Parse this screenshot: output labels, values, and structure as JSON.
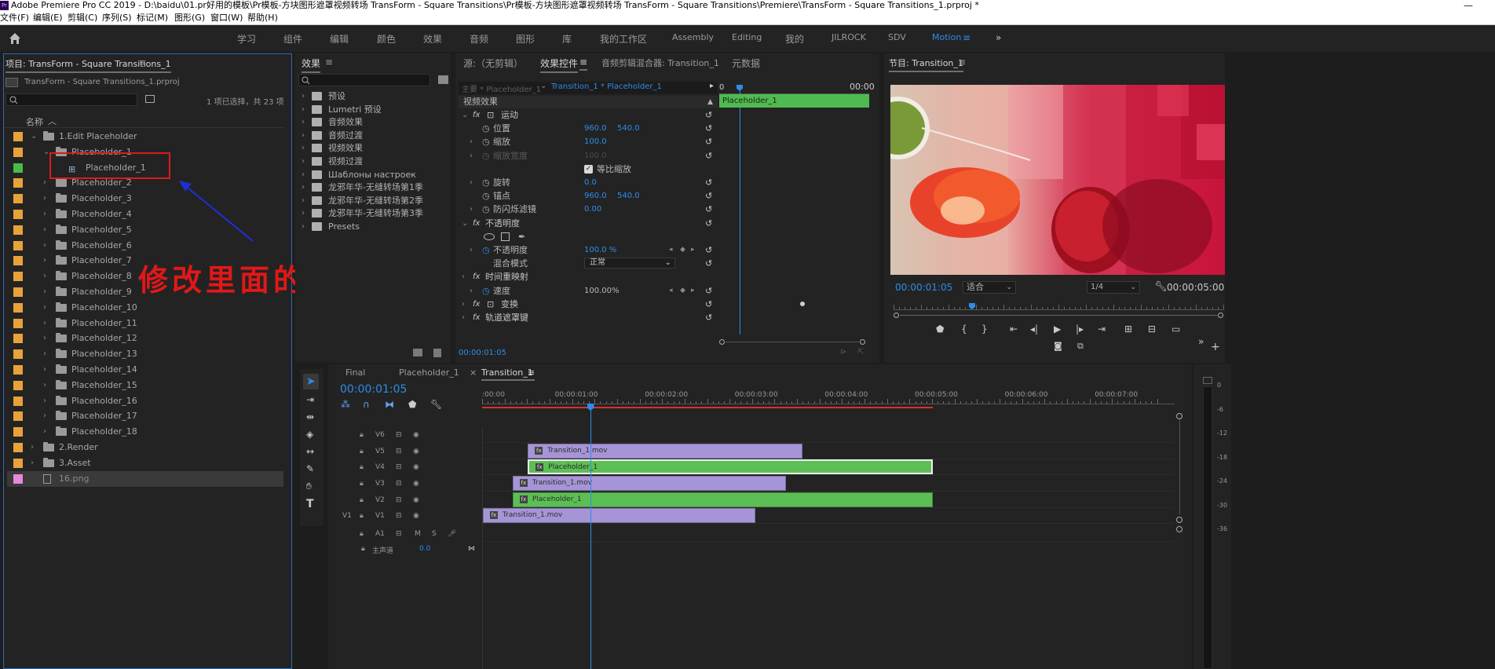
{
  "title_bar": {
    "app_badge": "Pr",
    "title": "Adobe Premiere Pro CC 2019 - D:\\baidu\\01.pr好用的模板\\Pr模板-方块图形遮罩视频转场 TransForm - Square Transitions\\Pr模板-方块图形遮罩视频转场 TransForm - Square Transitions\\Premiere\\TransForm - Square Transitions_1.prproj *",
    "minimize": "—",
    "maximize": "❐"
  },
  "menu": [
    "文件(F)",
    "编辑(E)",
    "剪辑(C)",
    "序列(S)",
    "标记(M)",
    "图形(G)",
    "窗口(W)",
    "帮助(H)"
  ],
  "workspaces": {
    "items": [
      "学习",
      "组件",
      "编辑",
      "颜色",
      "效果",
      "音频",
      "图形",
      "库",
      "我的工作区",
      "Assembly",
      "Editing",
      "我的",
      "JILROCK",
      "SDV",
      "Motion"
    ],
    "active": "Motion",
    "more": "»"
  },
  "project": {
    "tab": "项目: TransForm - Square Transitions_1",
    "file": "TransForm - Square Transitions_1.prproj",
    "selection": "1 项已选择，共 23 项",
    "column": "名称",
    "items": [
      {
        "label": "1.Edit Placeholder",
        "color": "#e8a23a",
        "depth": 0,
        "expanded": true
      },
      {
        "label": "Placeholder_1",
        "color": "#e8a23a",
        "depth": 1,
        "expanded": true
      },
      {
        "label": "Placeholder_1",
        "color": "#4aba4a",
        "depth": 2,
        "kind": "sequence"
      },
      {
        "label": "Placeholder_2",
        "color": "#e8a23a",
        "depth": 1
      },
      {
        "label": "Placeholder_3",
        "color": "#e8a23a",
        "depth": 1
      },
      {
        "label": "Placeholder_4",
        "color": "#e8a23a",
        "depth": 1
      },
      {
        "label": "Placeholder_5",
        "color": "#e8a23a",
        "depth": 1
      },
      {
        "label": "Placeholder_6",
        "color": "#e8a23a",
        "depth": 1
      },
      {
        "label": "Placeholder_7",
        "color": "#e8a23a",
        "depth": 1
      },
      {
        "label": "Placeholder_8",
        "color": "#e8a23a",
        "depth": 1
      },
      {
        "label": "Placeholder_9",
        "color": "#e8a23a",
        "depth": 1
      },
      {
        "label": "Placeholder_10",
        "color": "#e8a23a",
        "depth": 1
      },
      {
        "label": "Placeholder_11",
        "color": "#e8a23a",
        "depth": 1
      },
      {
        "label": "Placeholder_12",
        "color": "#e8a23a",
        "depth": 1
      },
      {
        "label": "Placeholder_13",
        "color": "#e8a23a",
        "depth": 1
      },
      {
        "label": "Placeholder_14",
        "color": "#e8a23a",
        "depth": 1
      },
      {
        "label": "Placeholder_15",
        "color": "#e8a23a",
        "depth": 1
      },
      {
        "label": "Placeholder_16",
        "color": "#e8a23a",
        "depth": 1
      },
      {
        "label": "Placeholder_17",
        "color": "#e8a23a",
        "depth": 1
      },
      {
        "label": "Placeholder_18",
        "color": "#e8a23a",
        "depth": 1
      },
      {
        "label": "2.Render",
        "color": "#e8a23a",
        "depth": 0
      },
      {
        "label": "3.Asset",
        "color": "#e8a23a",
        "depth": 0
      },
      {
        "label": "16.png",
        "color": "#e58ad6",
        "depth": 1,
        "kind": "image"
      }
    ]
  },
  "annotation": {
    "text": "修改里面的图片即可",
    "color": "#e01818",
    "arrow_color": "#1f2fd6"
  },
  "effects": {
    "tab": "效果",
    "items": [
      "预设",
      "Lumetri 预设",
      "音频效果",
      "音频过渡",
      "视频效果",
      "视频过渡",
      "Шаблоны настроек",
      "龙邪年华-无缝转场第1季",
      "龙邪年华-无缝转场第2季",
      "龙邪年华-无缝转场第3季",
      "Presets"
    ]
  },
  "effect_controls": {
    "tabs": [
      "源:（无剪辑）",
      "效果控件",
      "音频剪辑混合器: Transition_1",
      "元数据"
    ],
    "master": "主要 * Placeholder_1",
    "clip": "Transition_1 * Placeholder_1",
    "ruler": {
      "start": "0",
      "end": "00:00"
    },
    "clip_bar": "Placeholder_1",
    "section": "视频效果",
    "props": [
      {
        "name": "运动",
        "fx": true,
        "level": 0
      },
      {
        "name": "位置",
        "level": 1,
        "stopwatch": true,
        "v1": "960.0",
        "v2": "540.0"
      },
      {
        "name": "缩放",
        "level": 1,
        "stopwatch": true,
        "arrow": true,
        "v1": "100.0"
      },
      {
        "name": "缩放宽度",
        "level": 1,
        "stopwatch": true,
        "arrow": true,
        "v1": "100.0",
        "dim": true
      },
      {
        "name": "",
        "level": 1,
        "checkbox": "等比缩放"
      },
      {
        "name": "旋转",
        "level": 1,
        "stopwatch": true,
        "arrow": true,
        "v1": "0.0"
      },
      {
        "name": "锚点",
        "level": 1,
        "stopwatch": true,
        "v1": "960.0",
        "v2": "540.0"
      },
      {
        "name": "防闪烁滤镜",
        "level": 1,
        "stopwatch": true,
        "arrow": true,
        "v1": "0.00"
      },
      {
        "name": "不透明度",
        "fx": true,
        "level": 0
      },
      {
        "name": "",
        "level": 1,
        "shapes": true
      },
      {
        "name": "不透明度",
        "level": 1,
        "stopwatch": true,
        "arrow": true,
        "v1": "100.0 %",
        "kf": true
      },
      {
        "name": "混合模式",
        "level": 1,
        "dropdown": "正常"
      },
      {
        "name": "时间重映射",
        "fx": true,
        "level": 0
      },
      {
        "name": "速度",
        "level": 1,
        "stopwatch": true,
        "arrow": true,
        "v1": "100.00%",
        "kf": true,
        "plain": true
      },
      {
        "name": "变换",
        "fx": true,
        "level": 0,
        "icon": true
      },
      {
        "name": "轨道遮罩键",
        "fx": true,
        "level": 0
      }
    ],
    "timecode": "00:00:01:05"
  },
  "program": {
    "tab": "节目: Transition_1",
    "timecode": "00:00:01:05",
    "fit": "适合",
    "quality": "1/4",
    "duration": "00:00:05:00"
  },
  "timeline": {
    "tabs": [
      "Final",
      "Placeholder_1",
      "Transition_1"
    ],
    "active_tab": "Transition_1",
    "timecode": "00:00:01:05",
    "ruler_labels": [
      ":00:00",
      "00:00:01:00",
      "00:00:02:00",
      "00:00:03:00",
      "00:00:04:00",
      "00:00:05:00",
      "00:00:06:00",
      "00:00:07:00"
    ],
    "tracks": [
      {
        "name": "V6",
        "src": ""
      },
      {
        "name": "V5",
        "src": ""
      },
      {
        "name": "V4",
        "src": ""
      },
      {
        "name": "V3",
        "src": ""
      },
      {
        "name": "V2",
        "src": ""
      },
      {
        "name": "V1",
        "src": "V1"
      },
      {
        "name": "A1",
        "src": "",
        "audio": true
      }
    ],
    "clips": [
      {
        "label": "Transition_1.mov",
        "track": "V5",
        "start_s": 0.5,
        "end_s": 3.55,
        "kind": "purple"
      },
      {
        "label": "Placeholder_1",
        "track": "V4",
        "start_s": 0.5,
        "end_s": 5.0,
        "kind": "green",
        "selected": true
      },
      {
        "label": "Transition_1.mov",
        "track": "V3",
        "start_s": 0.33,
        "end_s": 3.37,
        "kind": "purple"
      },
      {
        "label": "Placeholder_1",
        "track": "V2",
        "start_s": 0.33,
        "end_s": 5.0,
        "kind": "green"
      },
      {
        "label": "Transition_1.mov",
        "track": "V1",
        "start_s": 0.0,
        "end_s": 3.03,
        "kind": "purple"
      }
    ],
    "master": {
      "label": "主声道",
      "value": "0.0"
    },
    "playhead_s": 1.2
  },
  "meter_labels": [
    "0",
    "-6",
    "-12",
    "-18",
    "-24",
    "-30",
    "-36"
  ]
}
